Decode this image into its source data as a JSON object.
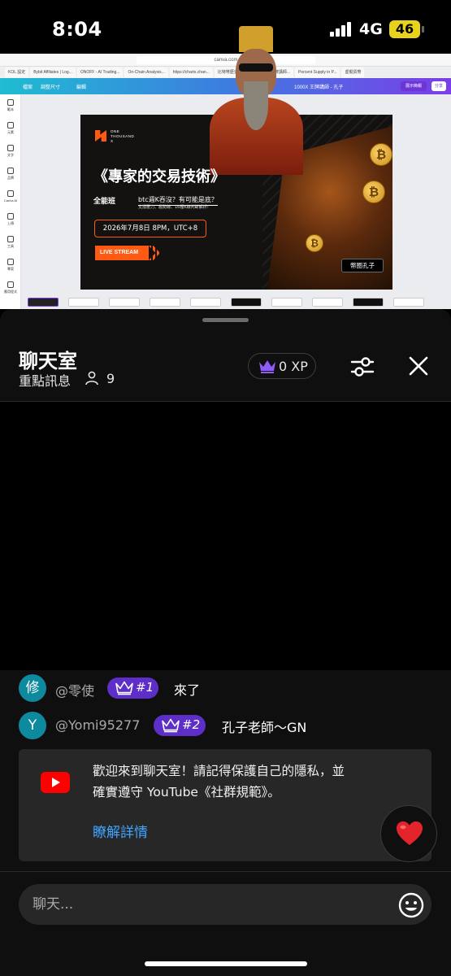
{
  "status_bar": {
    "time": "8:04",
    "network": "4G",
    "battery": "46",
    "battery_color": "#e8d21a"
  },
  "video": {
    "browser_url": "canva.com",
    "browser_tabs": [
      "KOL 設定",
      "Bybit Affiliates | Log...",
      "ONOFF - AI Trading...",
      "On-Chain Analysis...",
      "https://charts.chan...",
      "比特幣歷史價格...",
      "1000X 王牌講師...",
      "Percent Supply in P...",
      "虛擬貨幣"
    ],
    "canva_toolbar": {
      "file": "檔案",
      "resize": "調整尺寸",
      "edit": "編輯",
      "doc_title": "1000X 王牌講師 - 孔子",
      "present": "展示簡報",
      "share": "分享"
    },
    "canva_side": [
      "範本",
      "元素",
      "文字",
      "品牌",
      "Canva AI",
      "上傳",
      "工具",
      "專案",
      "應用程式"
    ],
    "slide": {
      "brand_line1": "ONE",
      "brand_line2": "THOUSAND",
      "brand_line3": "X",
      "title": "《專家的交易技術》",
      "class_label": "全能班",
      "question": "btc週K吞沒？有可能是底？",
      "sub": "支撐壓力、趨勢線、16種K線判斷解析！",
      "date": "2026年7月8日 8PM，UTC+8",
      "live": "LIVE STREAM",
      "name_tag": "幣圈孔子",
      "coin_symbol": "₿",
      "accent_color": "#ff5a14"
    }
  },
  "chat": {
    "title": "聊天室",
    "subtitle": "重點訊息",
    "viewer_count": "9",
    "xp": "0 XP",
    "messages": [
      {
        "avatar": "修",
        "author": "@零使",
        "rank": "#1",
        "text": "來了"
      },
      {
        "avatar": "Y",
        "author": "@Yomi95277",
        "rank": "#2",
        "text": "孔子老師～GN"
      }
    ],
    "notice": {
      "text": "歡迎來到聊天室！請記得保護自己的隱私，並確實遵守 YouTube《社群規範》。",
      "link": "瞭解詳情"
    },
    "input_placeholder": "聊天...",
    "colors": {
      "badge": "#5d2fc8",
      "avatar": "#0e8a9e",
      "link": "#3ea6ff",
      "youtube_red": "#ff0000"
    }
  }
}
